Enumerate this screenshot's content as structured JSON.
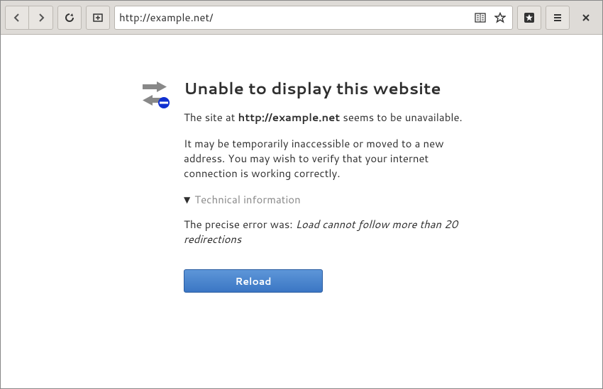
{
  "toolbar": {
    "url": "http://example.net/"
  },
  "error": {
    "title": "Unable to display this website",
    "line1_prefix": "The site at ",
    "line1_url": "http://example.net",
    "line1_suffix": " seems to be unavailable.",
    "line2": "It may be temporarily inaccessible or moved to a new address. You may wish to verify that your internet connection is working correctly.",
    "tech_label": "Technical information",
    "precise_prefix": "The precise error was: ",
    "precise_msg": "Load cannot follow more than 20 redirections",
    "reload_label": "Reload"
  }
}
